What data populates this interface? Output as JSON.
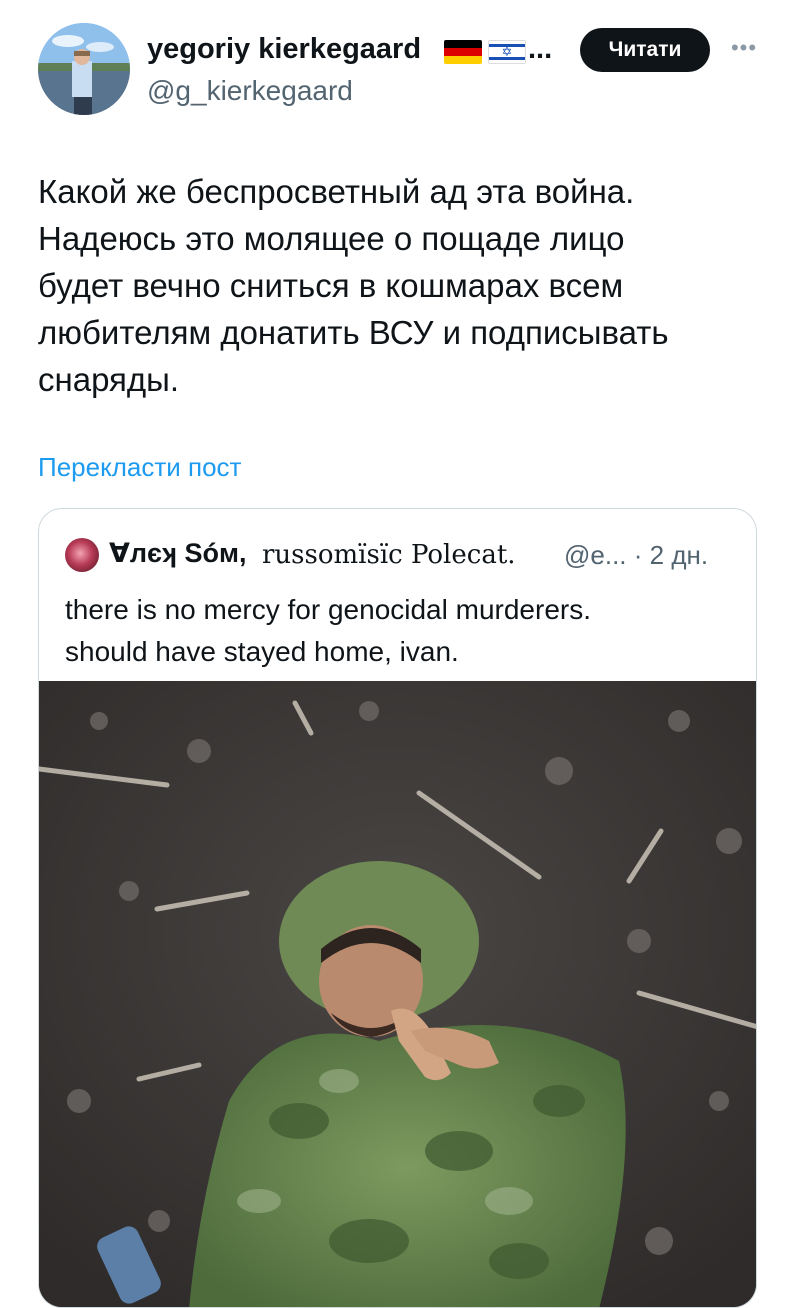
{
  "author": {
    "display_name": "yegoriy kierkegaard",
    "name_overflow": "...",
    "handle": "@g_kierkegaard",
    "flags": [
      "germany-flag",
      "israel-flag"
    ]
  },
  "follow_button": {
    "label": "Читати"
  },
  "more_icon": "more-horizontal-icon",
  "tweet": {
    "text": "Какой же беспросветный ад эта война.\nНадеюсь это молящее о пощаде лицо\nбудет вечно сниться в кошмарах всем\nлюбителям донатить ВСУ и подписывать\nснаряды."
  },
  "translate_link": "Перекласти пост",
  "quote": {
    "display_name": "Ɐлєʞ Sóм,",
    "sub_name": "russomïsïc Polecat.",
    "handle_time": "@e... · 2 дн.",
    "text": "there is no mercy for genocidal murderers.\nshould have stayed home, ivan."
  },
  "colors": {
    "text": "#0f1419",
    "secondary": "#536471",
    "link": "#1d9bf0",
    "border": "#cfd9de",
    "button_bg": "#0f1419"
  }
}
